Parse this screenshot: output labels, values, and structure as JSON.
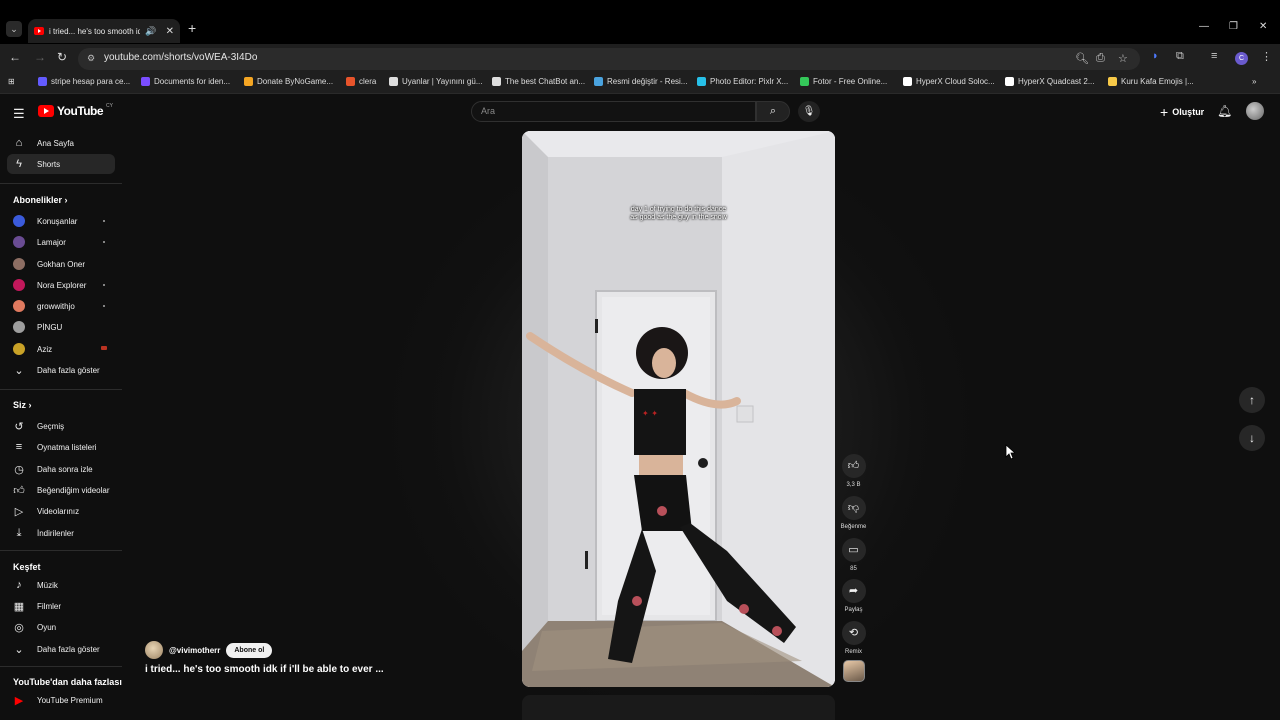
{
  "browser": {
    "tab_title": "i tried... he's too smooth idk",
    "tab_close": "✕",
    "new_tab": "+",
    "url": "youtube.com/shorts/voWEA-3I4Do"
  },
  "bookmarks": [
    {
      "label": "stripe hesap para ce...",
      "color": "#635bff"
    },
    {
      "label": "Documents for iden...",
      "color": "#7a4dff"
    },
    {
      "label": "Donate ByNoGame...",
      "color": "#f5a623"
    },
    {
      "label": "clera",
      "color": "#e8542b"
    },
    {
      "label": "Uyanlar | Yayınını gü...",
      "color": "#dddddd"
    },
    {
      "label": "The best ChatBot an...",
      "color": "#dddddd"
    },
    {
      "label": "Resmi değiştir - Resi...",
      "color": "#4aa3df"
    },
    {
      "label": "Photo Editor: Pixlr X...",
      "color": "#27c0e8"
    },
    {
      "label": "Fotor - Free Online...",
      "color": "#34c759"
    },
    {
      "label": "HyperX Cloud Soloc...",
      "color": "#ffffff"
    },
    {
      "label": "HyperX Quadcast 2...",
      "color": "#ffffff"
    },
    {
      "label": "Kuru Kafa Emojis |...",
      "color": "#f7c948"
    }
  ],
  "youtube": {
    "logo_text": "YouTube",
    "country_code": "CY",
    "search_placeholder": "Ara",
    "create_label": "Oluştur"
  },
  "sidebar": {
    "main": [
      {
        "label": "Ana Sayfa",
        "icon": "home-icon"
      },
      {
        "label": "Shorts",
        "icon": "shorts-icon",
        "active": true
      }
    ],
    "subscriptions_header": "Abonelikler",
    "subscriptions": [
      {
        "label": "Konuşanlar",
        "color": "#3b5bdb"
      },
      {
        "label": "Lamajor",
        "color": "#6a4c93"
      },
      {
        "label": "Gokhan Oner",
        "color": "#8d6e63"
      },
      {
        "label": "Nora Explorer",
        "color": "#c2185b"
      },
      {
        "label": "growwithjo",
        "color": "#e07a5f"
      },
      {
        "label": "PİNGU",
        "color": "#9e9e9e"
      },
      {
        "label": "Aziz",
        "color": "#c9a227"
      }
    ],
    "show_more": "Daha fazla göster",
    "you_header": "Siz",
    "you": [
      {
        "label": "Geçmiş",
        "icon": "history-icon"
      },
      {
        "label": "Oynatma listeleri",
        "icon": "playlist-icon"
      },
      {
        "label": "Daha sonra izle",
        "icon": "clock-icon"
      },
      {
        "label": "Beğendiğim videolar",
        "icon": "thumbs-up-icon"
      },
      {
        "label": "Videolarınız",
        "icon": "video-icon"
      },
      {
        "label": "İndirilenler",
        "icon": "download-icon"
      }
    ],
    "explore_header": "Keşfet",
    "explore": [
      {
        "label": "Müzik",
        "icon": "music-icon"
      },
      {
        "label": "Filmler",
        "icon": "film-icon"
      },
      {
        "label": "Oyun",
        "icon": "gamepad-icon"
      }
    ],
    "explore_more": "Daha fazla göster",
    "more_header": "YouTube'dan daha fazlası",
    "premium": "YouTube Premium"
  },
  "short": {
    "caption": "day 1 of trying to do this dance as good as the guy in the snow",
    "channel": "@vivimotherr",
    "subscribe": "Abone ol",
    "title": "i tried... he's too smooth idk if i'll be able to ever ..."
  },
  "actions": {
    "likes": "3,3 B",
    "dislike": "Beğenme",
    "comments": "85",
    "share": "Paylaş",
    "remix": "Remix"
  }
}
